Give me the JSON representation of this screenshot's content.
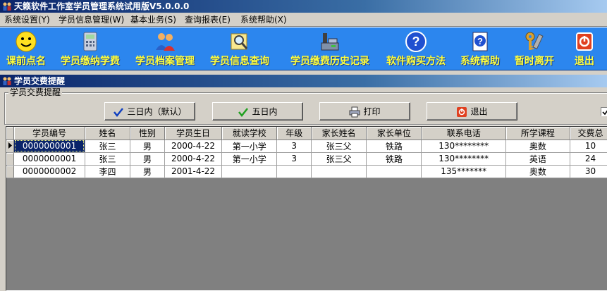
{
  "window": {
    "title": "天籁软件工作室学员管理系统试用版V5.0.0.0",
    "child_title": "学员交费提醒"
  },
  "menu": [
    {
      "label": "系统设置(Y)"
    },
    {
      "label": "学员信息管理(W)"
    },
    {
      "label": "基本业务(S)"
    },
    {
      "label": "查询报表(E)"
    },
    {
      "label": "系统帮助(X)"
    }
  ],
  "toolbar": [
    {
      "label": "课前点名",
      "icon": "smiley-icon"
    },
    {
      "label": "学员缴纳学费",
      "icon": "calculator-icon"
    },
    {
      "label": "学员档案管理",
      "icon": "people-icon"
    },
    {
      "label": "学员信息查询",
      "icon": "magnifier-icon"
    },
    {
      "label": "学员缴费历史记录",
      "icon": "cash-register-icon"
    },
    {
      "label": "软件购买方法",
      "icon": "help-icon"
    },
    {
      "label": "系统帮助",
      "icon": "help-book-icon"
    },
    {
      "label": "暂时离开",
      "icon": "keys-icon"
    },
    {
      "label": "退出",
      "icon": "exit-icon"
    }
  ],
  "group": {
    "caption": "学员交费提醒"
  },
  "buttons": {
    "three_days": "三日内（默认）",
    "five_days": "五日内",
    "print": "打印",
    "exit": "退出"
  },
  "table": {
    "columns": [
      "学员编号",
      "姓名",
      "性别",
      "学员生日",
      "就读学校",
      "年级",
      "家长姓名",
      "家长单位",
      "联系电话",
      "所学课程",
      "交费总"
    ],
    "rows": [
      [
        "0000000001",
        "张三",
        "男",
        "2000-4-22",
        "第一小学",
        "3",
        "张三父",
        "铁路",
        "130********",
        "奥数",
        "10"
      ],
      [
        "0000000001",
        "张三",
        "男",
        "2000-4-22",
        "第一小学",
        "3",
        "张三父",
        "铁路",
        "130********",
        "英语",
        "24"
      ],
      [
        "0000000002",
        "李四",
        "男",
        "2001-4-22",
        "",
        "",
        "",
        "",
        "135*******",
        "奥数",
        "30"
      ]
    ]
  },
  "colors": {
    "toolbar_bg": "#2c86ee",
    "toolbar_label": "#ffff3c",
    "titlebar": "#0a246a"
  }
}
